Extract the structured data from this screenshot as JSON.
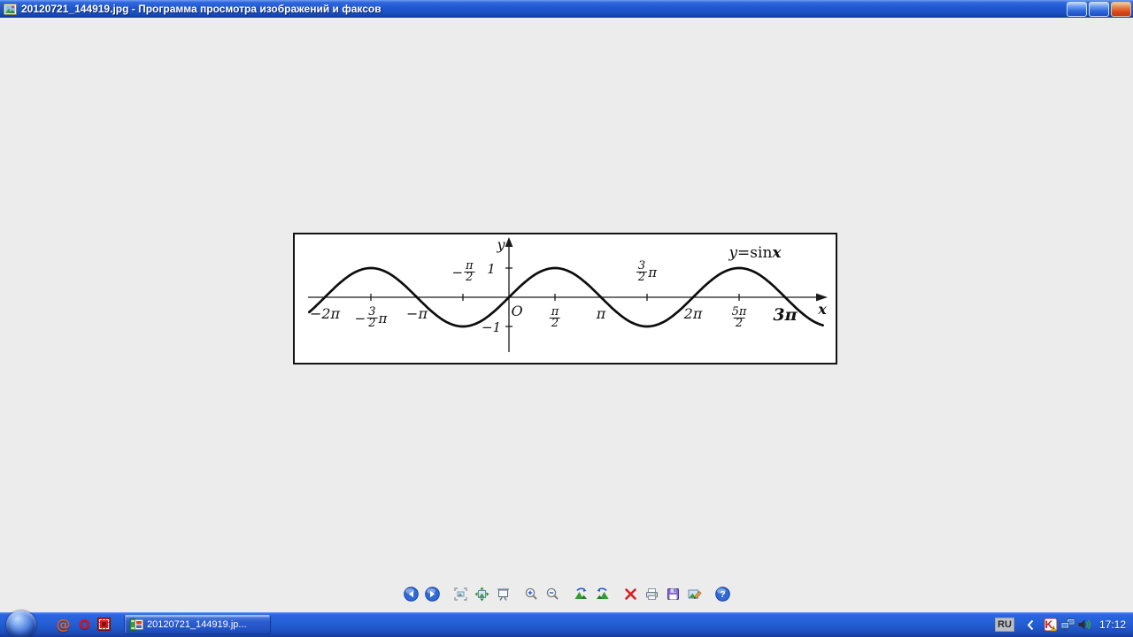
{
  "window": {
    "title": "20120721_144919.jpg - Программа просмотра изображений и факсов",
    "icon_name": "picture-viewer-icon",
    "controls": [
      "minimize-button",
      "maximize-button",
      "close-button"
    ]
  },
  "chart_data": {
    "type": "line",
    "function": "y = sin(x)",
    "curve_label": {
      "lhs": "y",
      "mid": "=sin",
      "rhs": "x"
    },
    "x_domain_pi": [
      -2.17,
      3.42
    ],
    "y_range": [
      -1,
      1
    ],
    "amplitude": 1,
    "axis": {
      "x_label": "x",
      "y_label": "y",
      "origin_label": "O"
    },
    "y_ticks": [
      {
        "value": 1,
        "label": "1"
      },
      {
        "value": -1,
        "label": "−1"
      }
    ],
    "x_tick_marks_pi": [
      -1.5,
      -0.5,
      0.5,
      1.5,
      2.5
    ],
    "x_tick_labels": [
      {
        "x_pi": -2,
        "side": "below",
        "kind": "plain",
        "text": "−2π"
      },
      {
        "x_pi": -1.5,
        "side": "below",
        "kind": "frac",
        "pre": "−",
        "num": "3",
        "den": "2",
        "post": "π"
      },
      {
        "x_pi": -1,
        "side": "below",
        "kind": "plain",
        "text": "−π"
      },
      {
        "x_pi": -0.5,
        "side": "above",
        "kind": "frac",
        "pre": "−",
        "num": "π",
        "den": "2",
        "post": ""
      },
      {
        "x_pi": 0.5,
        "side": "below",
        "kind": "frac",
        "pre": "",
        "num": "π",
        "den": "2",
        "post": ""
      },
      {
        "x_pi": 1,
        "side": "below",
        "kind": "plain",
        "text": "π"
      },
      {
        "x_pi": 1.5,
        "side": "above",
        "kind": "frac",
        "pre": "",
        "num": "3",
        "den": "2",
        "post": "π"
      },
      {
        "x_pi": 2,
        "side": "below",
        "kind": "plain",
        "text": "2π"
      },
      {
        "x_pi": 2.5,
        "side": "below",
        "kind": "frac",
        "pre": "",
        "num": "5π",
        "den": "2",
        "post": ""
      },
      {
        "x_pi": 3,
        "side": "below",
        "kind": "plain",
        "text": "3π",
        "big": true
      }
    ]
  },
  "toolbar": {
    "icon_names": [
      "previous-image",
      "next-image",
      "best-fit",
      "actual-size",
      "start-slideshow",
      "zoom-in",
      "zoom-out",
      "rotate-clockwise",
      "rotate-counterclockwise",
      "delete",
      "print",
      "copy-to",
      "edit",
      "help"
    ]
  },
  "taskbar": {
    "quick_launch": [
      "mail-at-icon",
      "opera-icon",
      "red-square-icon"
    ],
    "task_button": {
      "label": "20120721_144919.jp...",
      "icon_name": "picture-viewer-icon"
    },
    "tray": {
      "language_indicator": "RU",
      "icon_names": [
        "kaspersky-icon",
        "network-icon",
        "volume-icon"
      ],
      "clock": "17:12"
    }
  }
}
